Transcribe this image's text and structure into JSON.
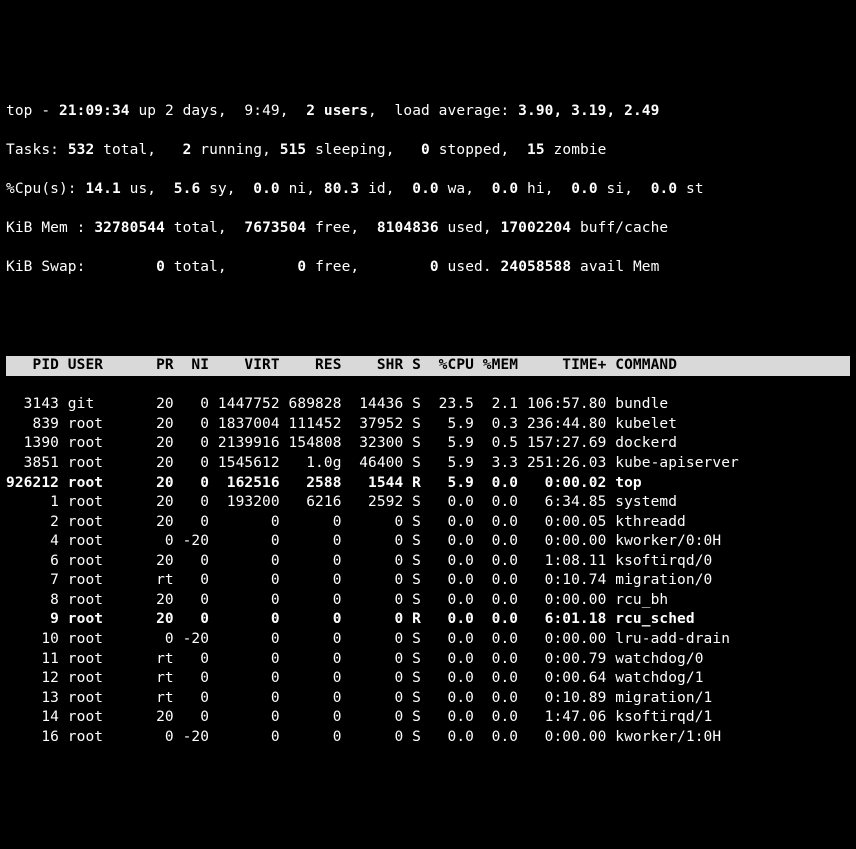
{
  "summary": {
    "line1": {
      "prefix": "top - ",
      "time": "21:09:34",
      "up": " up 2 days,  9:49,  ",
      "users": "2 users",
      "load_label": ",  load average: ",
      "loads": "3.90, 3.19, 2.49"
    },
    "line2": {
      "label": "Tasks: ",
      "total": "532 ",
      "total_lbl": "total,   ",
      "running": "2 ",
      "running_lbl": "running, ",
      "sleeping": "515 ",
      "sleeping_lbl": "sleeping,   ",
      "stopped": "0 ",
      "stopped_lbl": "stopped,  ",
      "zombie": "15 ",
      "zombie_lbl": "zombie"
    },
    "line3": {
      "label": "%Cpu(s): ",
      "us": "14.1 ",
      "us_lbl": "us,  ",
      "sy": "5.6 ",
      "sy_lbl": "sy,  ",
      "ni": "0.0 ",
      "ni_lbl": "ni, ",
      "id": "80.3 ",
      "id_lbl": "id,  ",
      "wa": "0.0 ",
      "wa_lbl": "wa,  ",
      "hi": "0.0 ",
      "hi_lbl": "hi,  ",
      "si": "0.0 ",
      "si_lbl": "si,  ",
      "st": "0.0 ",
      "st_lbl": "st"
    },
    "line4": {
      "label": "KiB Mem : ",
      "total": "32780544 ",
      "total_lbl": "total,  ",
      "free": "7673504 ",
      "free_lbl": "free,  ",
      "used": "8104836 ",
      "used_lbl": "used, ",
      "buff": "17002204 ",
      "buff_lbl": "buff/cache"
    },
    "line5": {
      "label": "KiB Swap: ",
      "total": "       0 ",
      "total_lbl": "total,        ",
      "free": "0 ",
      "free_lbl": "free,        ",
      "used": "0 ",
      "used_lbl": "used. ",
      "avail": "24058588 ",
      "avail_lbl": "avail Mem"
    }
  },
  "columns": [
    "PID",
    "USER",
    "PR",
    "NI",
    "VIRT",
    "RES",
    "SHR",
    "S",
    "%CPU",
    "%MEM",
    "TIME+",
    "COMMAND"
  ],
  "header_line": "   PID USER      PR  NI    VIRT    RES    SHR S  %CPU %MEM     TIME+ COMMAND            ",
  "processes": [
    {
      "pid": "3143",
      "user": "git",
      "pr": "20",
      "ni": "0",
      "virt": "1447752",
      "res": "689828",
      "shr": "14436",
      "s": "S",
      "cpu": "23.5",
      "mem": "2.1",
      "time": "106:57.80",
      "cmd": "bundle",
      "bold": false
    },
    {
      "pid": "839",
      "user": "root",
      "pr": "20",
      "ni": "0",
      "virt": "1837004",
      "res": "111452",
      "shr": "37952",
      "s": "S",
      "cpu": "5.9",
      "mem": "0.3",
      "time": "236:44.80",
      "cmd": "kubelet",
      "bold": false
    },
    {
      "pid": "1390",
      "user": "root",
      "pr": "20",
      "ni": "0",
      "virt": "2139916",
      "res": "154808",
      "shr": "32300",
      "s": "S",
      "cpu": "5.9",
      "mem": "0.5",
      "time": "157:27.69",
      "cmd": "dockerd",
      "bold": false
    },
    {
      "pid": "3851",
      "user": "root",
      "pr": "20",
      "ni": "0",
      "virt": "1545612",
      "res": "1.0g",
      "shr": "46400",
      "s": "S",
      "cpu": "5.9",
      "mem": "3.3",
      "time": "251:26.03",
      "cmd": "kube-apiserver",
      "bold": false
    },
    {
      "pid": "926212",
      "user": "root",
      "pr": "20",
      "ni": "0",
      "virt": "162516",
      "res": "2588",
      "shr": "1544",
      "s": "R",
      "cpu": "5.9",
      "mem": "0.0",
      "time": "0:00.02",
      "cmd": "top",
      "bold": true
    },
    {
      "pid": "1",
      "user": "root",
      "pr": "20",
      "ni": "0",
      "virt": "193200",
      "res": "6216",
      "shr": "2592",
      "s": "S",
      "cpu": "0.0",
      "mem": "0.0",
      "time": "6:34.85",
      "cmd": "systemd",
      "bold": false
    },
    {
      "pid": "2",
      "user": "root",
      "pr": "20",
      "ni": "0",
      "virt": "0",
      "res": "0",
      "shr": "0",
      "s": "S",
      "cpu": "0.0",
      "mem": "0.0",
      "time": "0:00.05",
      "cmd": "kthreadd",
      "bold": false
    },
    {
      "pid": "4",
      "user": "root",
      "pr": "0",
      "ni": "-20",
      "virt": "0",
      "res": "0",
      "shr": "0",
      "s": "S",
      "cpu": "0.0",
      "mem": "0.0",
      "time": "0:00.00",
      "cmd": "kworker/0:0H",
      "bold": false
    },
    {
      "pid": "6",
      "user": "root",
      "pr": "20",
      "ni": "0",
      "virt": "0",
      "res": "0",
      "shr": "0",
      "s": "S",
      "cpu": "0.0",
      "mem": "0.0",
      "time": "1:08.11",
      "cmd": "ksoftirqd/0",
      "bold": false
    },
    {
      "pid": "7",
      "user": "root",
      "pr": "rt",
      "ni": "0",
      "virt": "0",
      "res": "0",
      "shr": "0",
      "s": "S",
      "cpu": "0.0",
      "mem": "0.0",
      "time": "0:10.74",
      "cmd": "migration/0",
      "bold": false
    },
    {
      "pid": "8",
      "user": "root",
      "pr": "20",
      "ni": "0",
      "virt": "0",
      "res": "0",
      "shr": "0",
      "s": "S",
      "cpu": "0.0",
      "mem": "0.0",
      "time": "0:00.00",
      "cmd": "rcu_bh",
      "bold": false
    },
    {
      "pid": "9",
      "user": "root",
      "pr": "20",
      "ni": "0",
      "virt": "0",
      "res": "0",
      "shr": "0",
      "s": "R",
      "cpu": "0.0",
      "mem": "0.0",
      "time": "6:01.18",
      "cmd": "rcu_sched",
      "bold": true
    },
    {
      "pid": "10",
      "user": "root",
      "pr": "0",
      "ni": "-20",
      "virt": "0",
      "res": "0",
      "shr": "0",
      "s": "S",
      "cpu": "0.0",
      "mem": "0.0",
      "time": "0:00.00",
      "cmd": "lru-add-drain",
      "bold": false
    },
    {
      "pid": "11",
      "user": "root",
      "pr": "rt",
      "ni": "0",
      "virt": "0",
      "res": "0",
      "shr": "0",
      "s": "S",
      "cpu": "0.0",
      "mem": "0.0",
      "time": "0:00.79",
      "cmd": "watchdog/0",
      "bold": false
    },
    {
      "pid": "12",
      "user": "root",
      "pr": "rt",
      "ni": "0",
      "virt": "0",
      "res": "0",
      "shr": "0",
      "s": "S",
      "cpu": "0.0",
      "mem": "0.0",
      "time": "0:00.64",
      "cmd": "watchdog/1",
      "bold": false
    },
    {
      "pid": "13",
      "user": "root",
      "pr": "rt",
      "ni": "0",
      "virt": "0",
      "res": "0",
      "shr": "0",
      "s": "S",
      "cpu": "0.0",
      "mem": "0.0",
      "time": "0:10.89",
      "cmd": "migration/1",
      "bold": false
    },
    {
      "pid": "14",
      "user": "root",
      "pr": "20",
      "ni": "0",
      "virt": "0",
      "res": "0",
      "shr": "0",
      "s": "S",
      "cpu": "0.0",
      "mem": "0.0",
      "time": "1:47.06",
      "cmd": "ksoftirqd/1",
      "bold": false
    },
    {
      "pid": "16",
      "user": "root",
      "pr": "0",
      "ni": "-20",
      "virt": "0",
      "res": "0",
      "shr": "0",
      "s": "S",
      "cpu": "0.0",
      "mem": "0.0",
      "time": "0:00.00",
      "cmd": "kworker/1:0H",
      "bold": false
    }
  ]
}
